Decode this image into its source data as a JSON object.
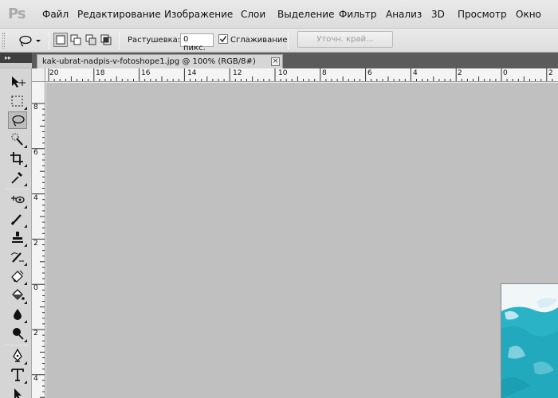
{
  "app": {
    "logo": "Ps"
  },
  "menu": [
    "Файл",
    "Редактирование",
    "Изображение",
    "Слои",
    "Выделение",
    "Фильтр",
    "Анализ",
    "3D",
    "Просмотр",
    "Окно"
  ],
  "options": {
    "feather_label": "Растушевка:",
    "feather_value": "0 пикс.",
    "antialias_label": "Сглаживание",
    "antialias_checked": true,
    "refine_edge": "Уточн. край..."
  },
  "toolbar": {
    "collapse_glyph": "▸▸",
    "active_tool": "lasso"
  },
  "document": {
    "tab_title": "kak-ubrat-nadpis-v-fotoshope1.jpg @ 100% (RGB/8#)",
    "close_glyph": "×"
  },
  "ruler_top": [
    "20",
    "18",
    "16",
    "14",
    "12",
    "10",
    "8",
    "6",
    "4",
    "2",
    "0",
    "2"
  ],
  "ruler_left": [
    "8",
    "6",
    "4",
    "2",
    "0",
    "2",
    "4"
  ],
  "colors": {
    "canvas": "#c0c0c0",
    "image_cyan": "#2ab3c6"
  }
}
